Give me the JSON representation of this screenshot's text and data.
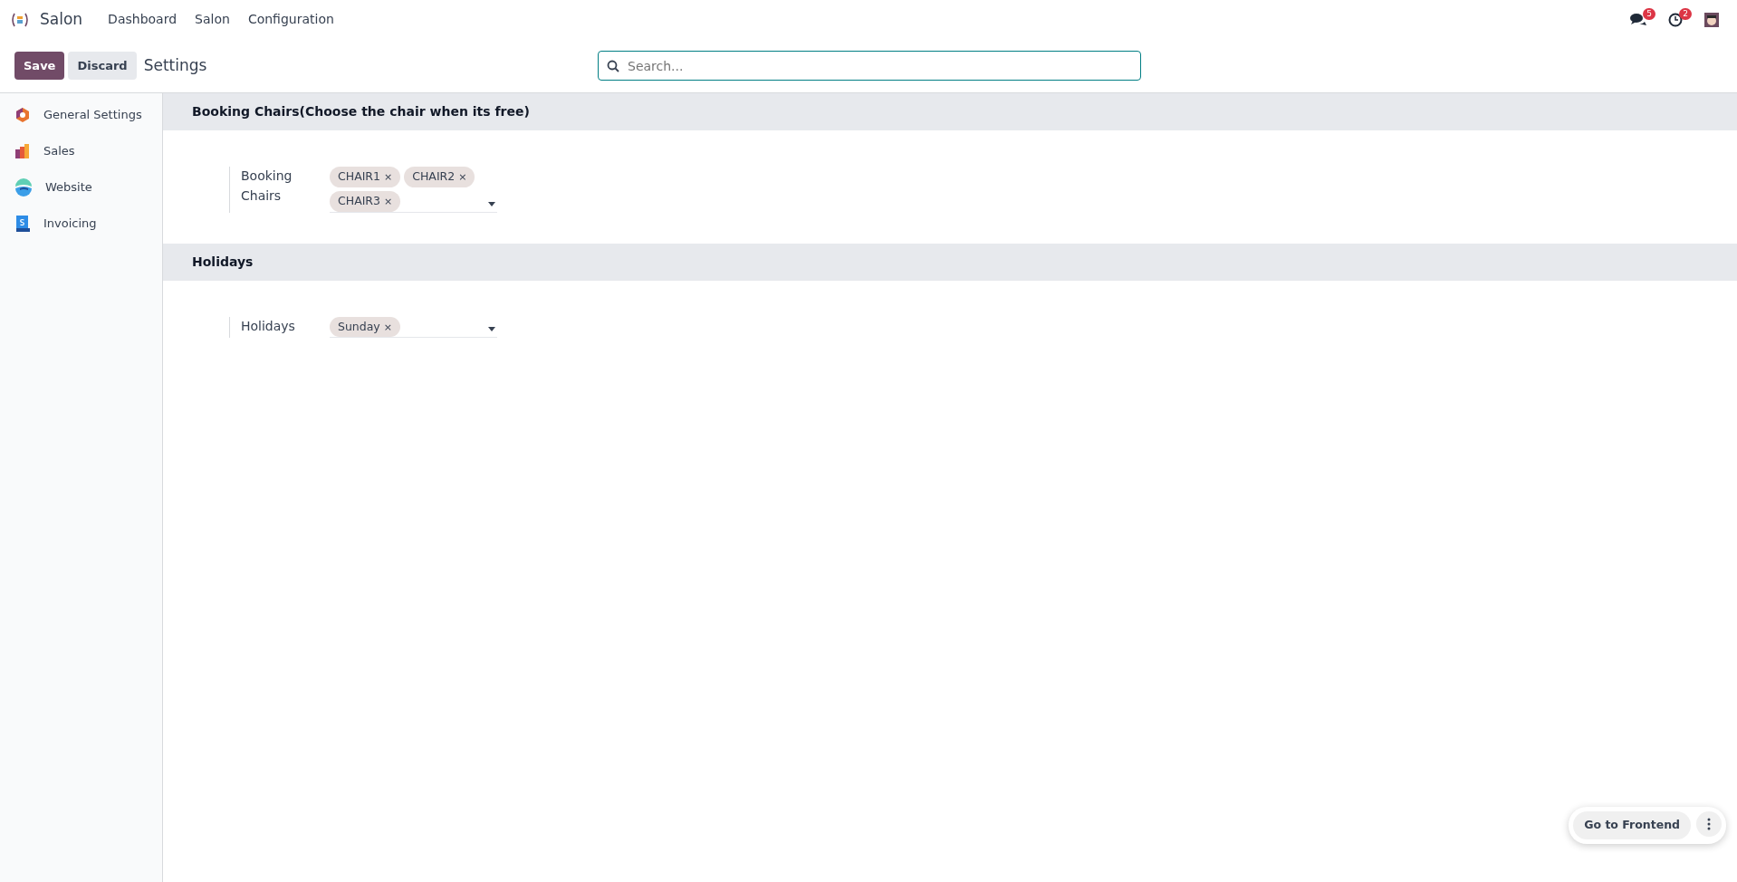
{
  "navbar": {
    "app_name": "Salon",
    "menu": [
      {
        "label": "Dashboard"
      },
      {
        "label": "Salon"
      },
      {
        "label": "Configuration"
      }
    ],
    "messages_badge": "5",
    "activities_badge": "2"
  },
  "control_panel": {
    "buttons": [
      {
        "label": "Save",
        "kind": "primary"
      },
      {
        "label": "Discard",
        "kind": "secondary"
      }
    ],
    "breadcrumb": "Settings",
    "search": {
      "placeholder": "Search..."
    }
  },
  "sidebar": {
    "items": [
      {
        "label": "General Settings",
        "kind": "general",
        "selected": false
      },
      {
        "label": "Sales",
        "kind": "sales",
        "selected": false
      },
      {
        "label": "Website",
        "kind": "website",
        "selected": false
      },
      {
        "label": "Invoicing",
        "kind": "invoicing",
        "selected": false
      }
    ]
  },
  "sections": [
    {
      "title": "Booking Chairs(Choose the chair when its free)",
      "field": {
        "label": "Booking Chairs",
        "tags": [
          {
            "label": "CHAIR1",
            "remove": "×"
          },
          {
            "label": "CHAIR2",
            "remove": "×"
          },
          {
            "label": "CHAIR3",
            "remove": "×"
          }
        ]
      }
    },
    {
      "title": "Holidays",
      "field": {
        "label": "Holidays",
        "tags": [
          {
            "label": "Sunday",
            "remove": "×"
          }
        ]
      }
    }
  ],
  "floating": {
    "button": "Go to Frontend"
  }
}
